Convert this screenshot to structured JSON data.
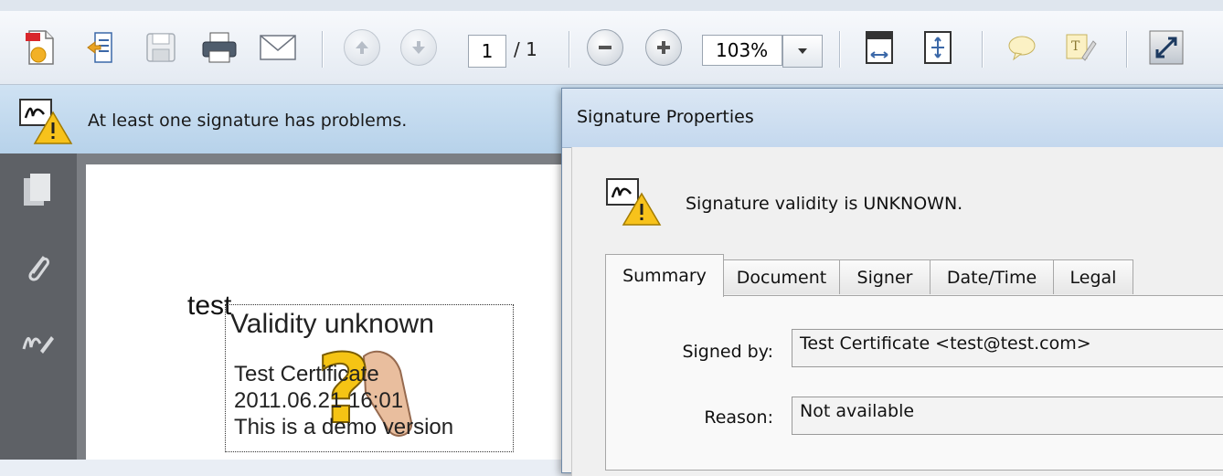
{
  "toolbar": {
    "buttons": [
      {
        "name": "create-icon"
      },
      {
        "name": "open-icon"
      },
      {
        "name": "save-icon"
      },
      {
        "name": "print-icon"
      },
      {
        "name": "email-icon"
      },
      {
        "name": "previous-page-icon"
      },
      {
        "name": "next-page-icon"
      }
    ],
    "page_current": "1",
    "page_total": "/ 1",
    "zoom_value": "103%"
  },
  "message_bar": {
    "text": "At least one signature has problems."
  },
  "document": {
    "text": "test",
    "signature_appearance": {
      "status": "Validity unknown",
      "signer": "Test Certificate",
      "date": "2011.06.21 16:01",
      "note": "This is a demo version"
    }
  },
  "dialog": {
    "title": "Signature Properties",
    "validity_message": "Signature validity is UNKNOWN.",
    "tabs": [
      "Summary",
      "Document",
      "Signer",
      "Date/Time",
      "Legal"
    ],
    "active_tab": "Summary",
    "fields": {
      "signed_by_label": "Signed by:",
      "signed_by_value": "Test Certificate <test@test.com>",
      "reason_label": "Reason:",
      "reason_value": "Not available"
    }
  },
  "colors": {
    "message_bar_bg": "#c2d9ef",
    "warning_yellow": "#f7c21b",
    "sidebar_bg": "#5e6166"
  }
}
